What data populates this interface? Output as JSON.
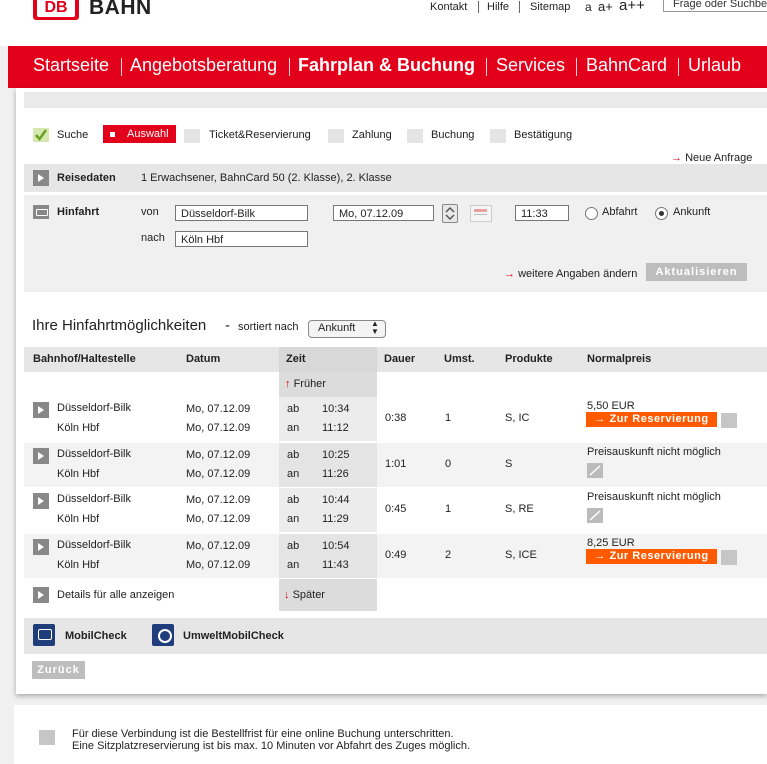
{
  "header": {
    "logo_text": "DB",
    "brand": "BAHN",
    "links": {
      "kontakt": "Kontakt",
      "hilfe": "Hilfe",
      "sitemap": "Sitemap",
      "a_small": "a",
      "a_plus": "a+",
      "a_plusplus": "a++"
    },
    "search_placeholder": "Frage oder Suchbe"
  },
  "nav": {
    "items": [
      "Startseite",
      "Angebotsberatung",
      "Fahrplan & Buchung",
      "Services",
      "BahnCard",
      "Urlaub"
    ],
    "active": "Fahrplan & Buchung"
  },
  "steps": {
    "suche": "Suche",
    "auswahl": "Auswahl",
    "ticket": "Ticket&Reservierung",
    "zahlung": "Zahlung",
    "buchung": "Buchung",
    "bestaetigung": "Bestätigung"
  },
  "neue_anfrage": "Neue Anfrage",
  "reisedaten": {
    "label": "Reisedaten",
    "value": "1 Erwachsener, BahnCard 50 (2. Klasse), 2. Klasse"
  },
  "hinfahrt": {
    "label": "Hinfahrt",
    "von_label": "von",
    "von_value": "Düsseldorf-Bilk",
    "nach_label": "nach",
    "nach_value": "Köln Hbf",
    "date": "Mo, 07.12.09",
    "time": "11:33",
    "abfahrt": "Abfahrt",
    "ankunft": "Ankunft",
    "selected": "Ankunft"
  },
  "weitere": "weitere Angaben ändern",
  "aktualisieren": "Aktualisieren",
  "results": {
    "title": "Ihre Hinfahrtmöglichkeiten",
    "dash": "-",
    "sort_label": "sortiert nach",
    "sort_value": "Ankunft",
    "columns": {
      "station": "Bahnhof/Haltestelle",
      "date": "Datum",
      "time": "Zeit",
      "duration": "Dauer",
      "changes": "Umst.",
      "products": "Produkte",
      "price": "Normalpreis"
    },
    "earlier": "Früher",
    "later": "Später",
    "ab": "ab",
    "an": "an",
    "rows": [
      {
        "from": "Düsseldorf-Bilk",
        "to": "Köln Hbf",
        "date_dep": "Mo, 07.12.09",
        "date_arr": "Mo, 07.12.09",
        "dep": "10:34",
        "arr": "11:12",
        "duration": "0:38",
        "changes": "1",
        "products": "S, IC",
        "price": "5,50 EUR",
        "reserve": "Zur Reservierung"
      },
      {
        "from": "Düsseldorf-Bilk",
        "to": "Köln Hbf",
        "date_dep": "Mo, 07.12.09",
        "date_arr": "Mo, 07.12.09",
        "dep": "10:25",
        "arr": "11:26",
        "duration": "1:01",
        "changes": "0",
        "products": "S",
        "price": "Preisauskunft nicht möglich"
      },
      {
        "from": "Düsseldorf-Bilk",
        "to": "Köln Hbf",
        "date_dep": "Mo, 07.12.09",
        "date_arr": "Mo, 07.12.09",
        "dep": "10:44",
        "arr": "11:29",
        "duration": "0:45",
        "changes": "1",
        "products": "S, RE",
        "price": "Preisauskunft nicht möglich"
      },
      {
        "from": "Düsseldorf-Bilk",
        "to": "Köln Hbf",
        "date_dep": "Mo, 07.12.09",
        "date_arr": "Mo, 07.12.09",
        "dep": "10:54",
        "arr": "11:43",
        "duration": "0:49",
        "changes": "2",
        "products": "S, ICE",
        "price": "8,25 EUR",
        "reserve": "Zur Reservierung"
      }
    ],
    "details_all": "Details für alle anzeigen"
  },
  "mobilcheck": "MobilCheck",
  "umweltmobilcheck": "UmweltMobilCheck",
  "zurueck": "Zurück",
  "note": {
    "line1": "Für diese Verbindung ist die Bestellfrist für eine online Buchung unterschritten.",
    "line2": "Eine Sitzplatzreservierung ist bis max. 10 Minuten vor Abfahrt des Zuges möglich."
  },
  "colors": {
    "db_red": "#e2001a",
    "reserve_orange": "#ff5a00"
  }
}
